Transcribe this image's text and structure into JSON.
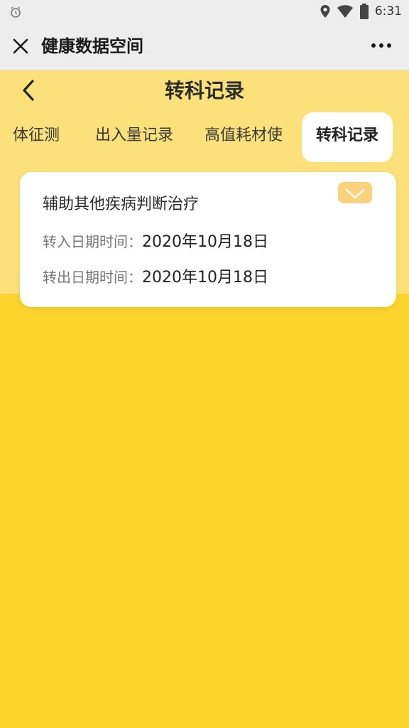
{
  "status_bar": {
    "time": "6:31",
    "icons": [
      "alarm-icon",
      "location-icon",
      "wifi-icon",
      "battery-icon"
    ]
  },
  "app_bar": {
    "title": "健康数据空间",
    "close_icon": "close-icon",
    "more_icon": "more-icon"
  },
  "header": {
    "title": "转科记录",
    "back_icon": "chevron-left-icon"
  },
  "tabs": [
    {
      "label": "体征测",
      "active": false
    },
    {
      "label": "出入量记录",
      "active": false
    },
    {
      "label": "高值耗材使",
      "active": false
    },
    {
      "label": "转科记录",
      "active": true
    }
  ],
  "record": {
    "title": "辅助其他疾病判断治疗",
    "transfer_in_label": "转入日期时间：",
    "transfer_in_value": "2020年10月18日",
    "transfer_out_label": "转出日期时间：",
    "transfer_out_value": "2020年10月18日",
    "expand_icon": "chevron-down-icon"
  },
  "colors": {
    "page_bg": "#FCD42C",
    "header_bg": "#FCE17A",
    "bar_bg": "#EDEDED",
    "accent": "#FAD27B",
    "card_bg": "#FFFFFF"
  }
}
